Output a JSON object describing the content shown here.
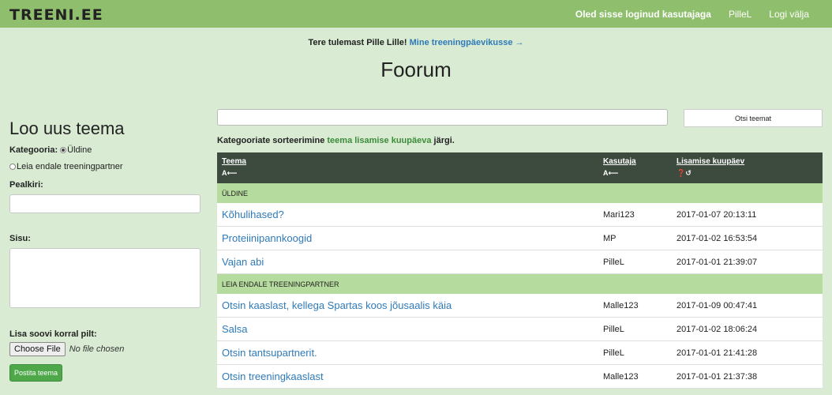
{
  "nav": {
    "brand": "TREENI.EE",
    "logged_in": "Oled sisse loginud kasutajaga",
    "user": "PilleL",
    "logout": "Logi välja"
  },
  "welcome": {
    "text": "Tere tulemast Pille Lille!",
    "link": "Mine treeningpäevikusse →"
  },
  "page_title": "Foorum",
  "new_topic": {
    "heading": "Loo uus teema",
    "category_label": "Kategooria:",
    "categories": [
      "Üldine",
      "Leia endale treeningpartner"
    ],
    "selected_category": "Üldine",
    "title_label": "Pealkiri:",
    "title_value": "",
    "content_label": "Sisu:",
    "content_value": "",
    "image_label": "Lisa soovi korral pilt:",
    "file_button": "Choose File",
    "file_status": "No file chosen",
    "submit": "Postita teema"
  },
  "search": {
    "value": "",
    "button": "Otsi teemat"
  },
  "sort": {
    "prefix": "Kategooriate sorteerimine",
    "highlight": "teema lisamise kuupäeva",
    "suffix": "järgi."
  },
  "table": {
    "columns": [
      {
        "label": "Teema",
        "sort": "A⟵"
      },
      {
        "label": "Kasutaja",
        "sort": "A⟵"
      },
      {
        "label": "Lisamise kuupäev",
        "sort": "❓↺"
      }
    ],
    "groups": [
      {
        "name": "ÜLDINE",
        "rows": [
          {
            "topic": "Kõhulihased?",
            "user": "Mari123",
            "date": "2017-01-07 20:13:11"
          },
          {
            "topic": "Proteiinipannkoogid",
            "user": "MP",
            "date": "2017-01-02 16:53:54"
          },
          {
            "topic": "Vajan abi",
            "user": "PilleL",
            "date": "2017-01-01 21:39:07"
          }
        ]
      },
      {
        "name": "LEIA ENDALE TREENINGPARTNER",
        "rows": [
          {
            "topic": "Otsin kaaslast, kellega Spartas koos jõusaalis käia",
            "user": "Malle123",
            "date": "2017-01-09 00:47:41"
          },
          {
            "topic": "Salsa",
            "user": "PilleL",
            "date": "2017-01-02 18:06:24"
          },
          {
            "topic": "Otsin tantsupartnerit.",
            "user": "PilleL",
            "date": "2017-01-01 21:41:28"
          },
          {
            "topic": "Otsin treeningkaaslast",
            "user": "Malle123",
            "date": "2017-01-01 21:37:38"
          }
        ]
      }
    ]
  }
}
